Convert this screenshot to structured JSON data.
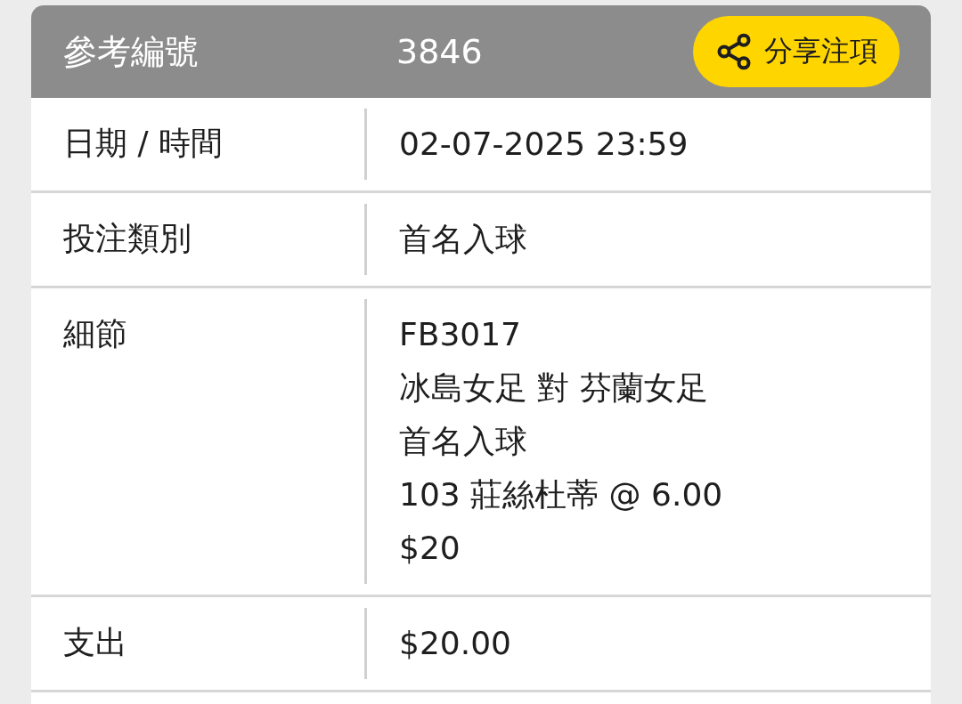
{
  "header": {
    "label": "參考編號",
    "value": "3846",
    "share_button": "分享注項"
  },
  "rows": [
    {
      "label": "日期 / 時間",
      "lines": [
        "02-07-2025 23:59"
      ]
    },
    {
      "label": "投注類別",
      "lines": [
        "首名入球"
      ]
    },
    {
      "label": "細節",
      "lines": [
        "FB3017",
        "冰島女足 對 芬蘭女足",
        "首名入球",
        "103 莊絲杜蒂 @ 6.00",
        "$20"
      ]
    },
    {
      "label": "支出",
      "lines": [
        "$20.00"
      ]
    }
  ]
}
